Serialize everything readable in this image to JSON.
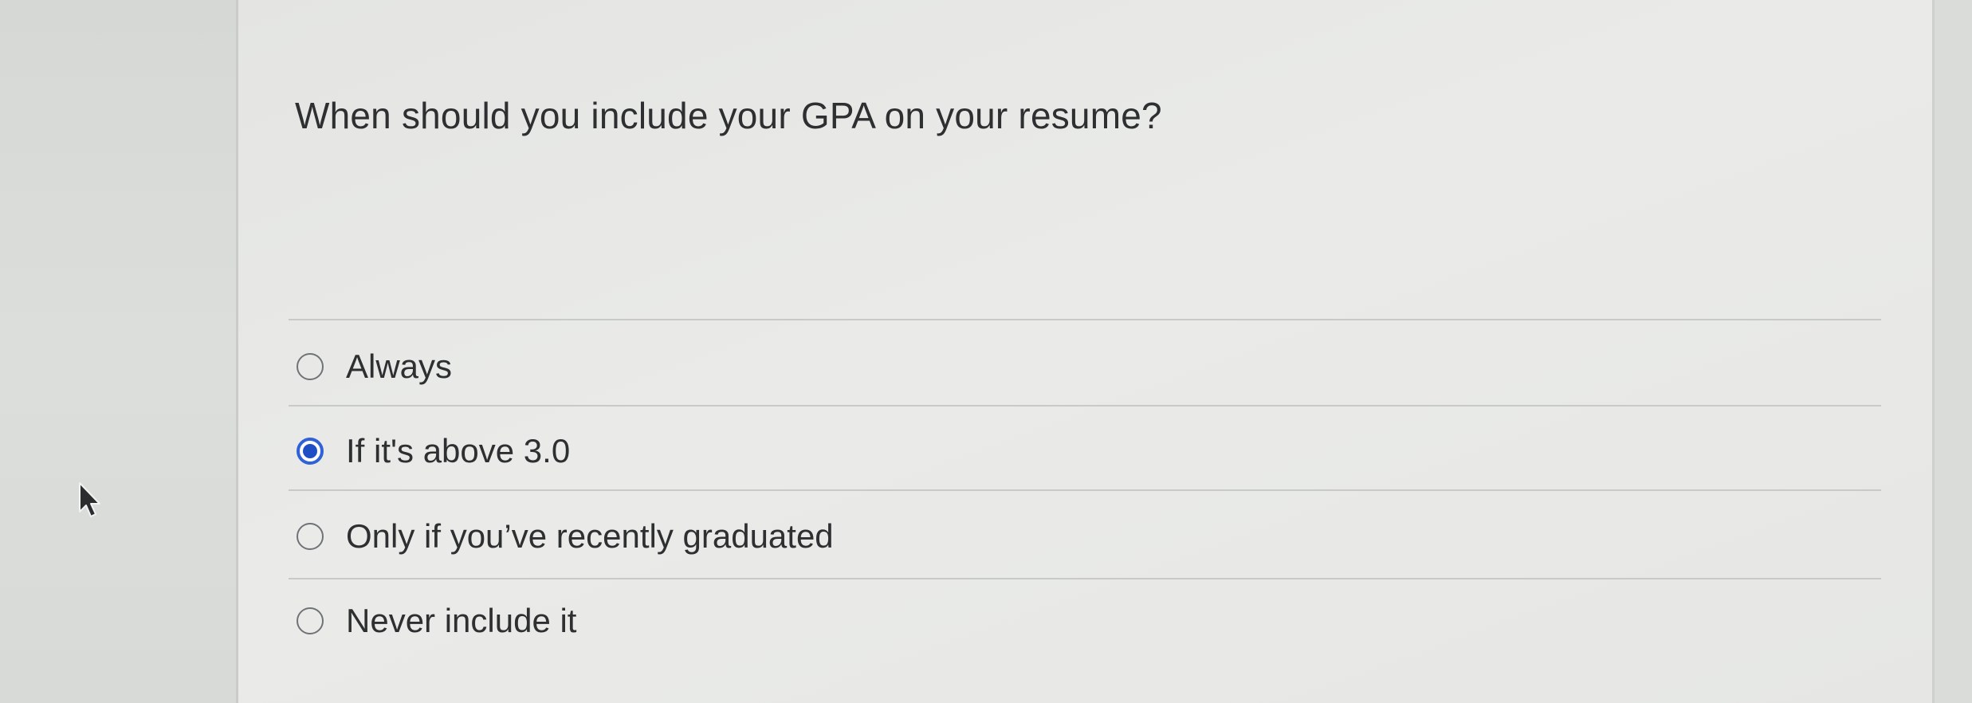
{
  "question": {
    "text": "When should you include your GPA on your resume?"
  },
  "answers": [
    {
      "label": "Always",
      "selected": false
    },
    {
      "label": "If it's above 3.0",
      "selected": true
    },
    {
      "label": "Only if you’ve recently graduated",
      "selected": false
    },
    {
      "label": "Never include it",
      "selected": false
    }
  ],
  "colors": {
    "selected_radio": "#2f62d6",
    "text": "#2d2f31",
    "divider": "#c7cac7"
  },
  "icons": {
    "cursor": "mouse-pointer-icon",
    "radio": "radio-button-icon"
  }
}
